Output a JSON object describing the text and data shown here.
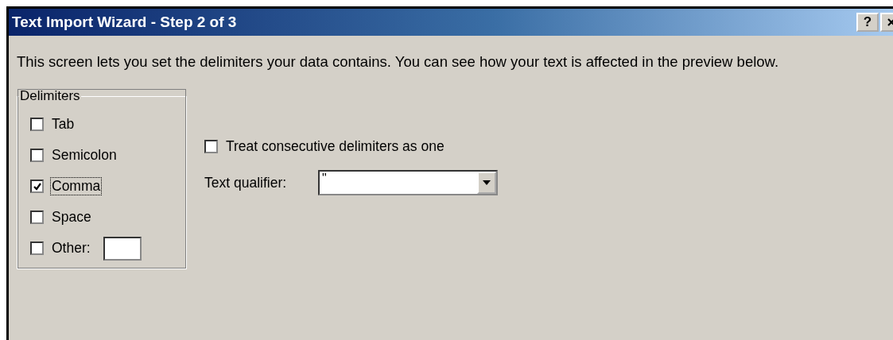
{
  "window": {
    "title": "Text Import Wizard - Step 2 of 3",
    "help_button": "?"
  },
  "description": "This screen lets you set the delimiters your data contains.  You can see how your text is affected in the preview below.",
  "delimiters": {
    "title": "Delimiters",
    "options": [
      {
        "label": "Tab",
        "checked": false,
        "focused": false
      },
      {
        "label": "Semicolon",
        "checked": false,
        "focused": false
      },
      {
        "label": "Comma",
        "checked": true,
        "focused": true
      },
      {
        "label": "Space",
        "checked": false,
        "focused": false
      },
      {
        "label": "Other:",
        "checked": false,
        "focused": false,
        "kind": "other"
      }
    ]
  },
  "consecutive": {
    "label": "Treat consecutive delimiters as one",
    "checked": false
  },
  "text_qualifier": {
    "label": "Text qualifier:",
    "value": "\""
  }
}
